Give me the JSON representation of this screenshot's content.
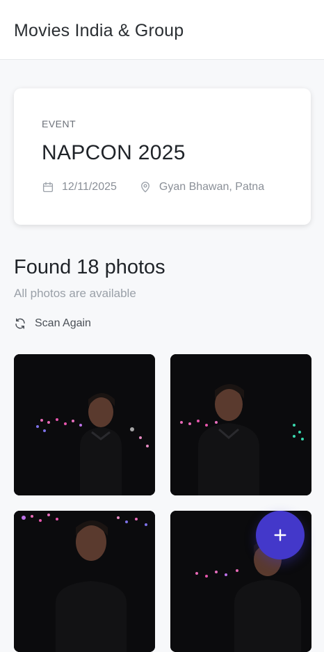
{
  "header": {
    "title": "Movies India & Group"
  },
  "event": {
    "kicker": "EVENT",
    "name": "NAPCON 2025",
    "date": "12/11/2025",
    "location": "Gyan Bhawan, Patna",
    "date_icon": "calendar-icon",
    "location_icon": "map-pin-icon"
  },
  "results": {
    "title": "Found 18 photos",
    "subtitle": "All photos are available",
    "scan_again_label": "Scan Again",
    "scan_icon": "refresh-icon"
  },
  "photos": [
    {
      "alt": "photo-1"
    },
    {
      "alt": "photo-2"
    },
    {
      "alt": "photo-3"
    },
    {
      "alt": "photo-4"
    }
  ],
  "fab": {
    "icon": "plus-icon",
    "color": "#4338ca"
  }
}
